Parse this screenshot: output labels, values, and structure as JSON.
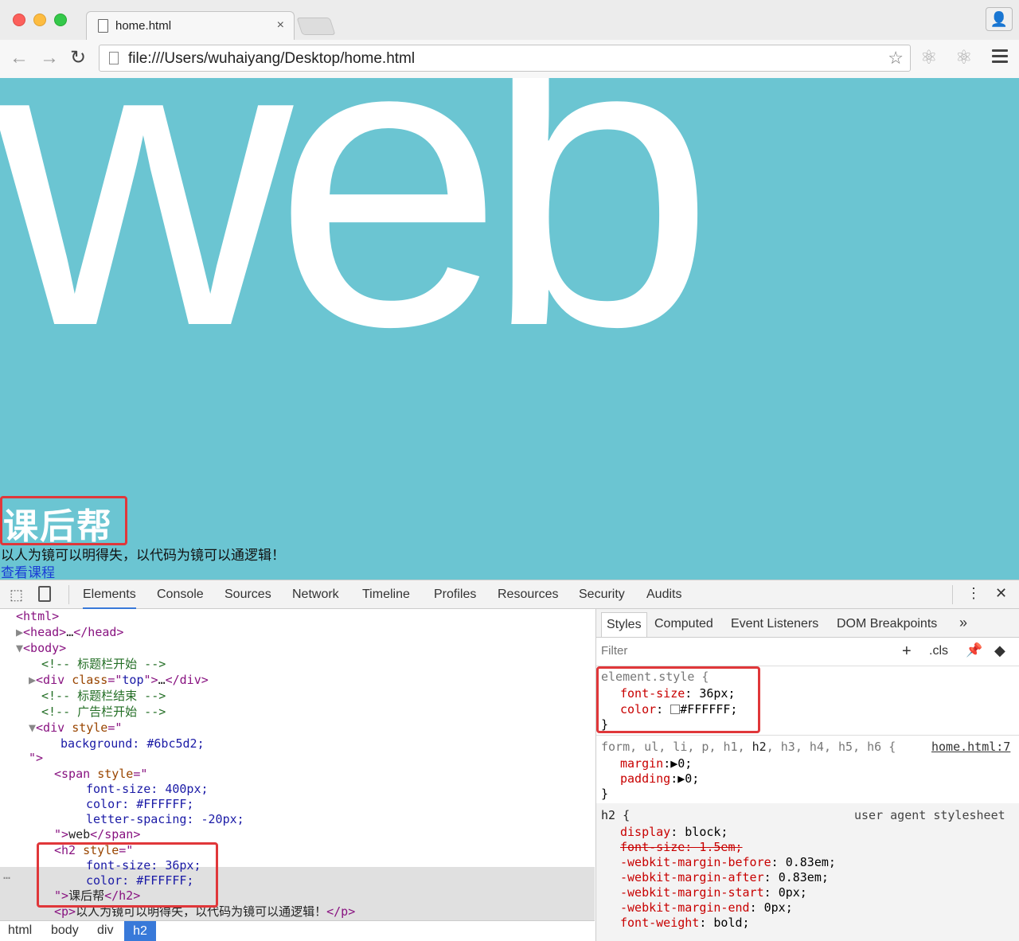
{
  "browser": {
    "tab_title": "home.html",
    "tab_close": "×",
    "url": "file:///Users/wuhaiyang/Desktop/home.html",
    "back": "←",
    "forward": "→",
    "reload": "↻",
    "star": "☆"
  },
  "page": {
    "big_word": "web",
    "heading": "课后帮",
    "paragraph": "以人为镜可以明得失，以代码为镜可以通逻辑！",
    "link": "查看课程",
    "background_color": "#6bc5d2"
  },
  "devtools": {
    "tabs": [
      "Elements",
      "Console",
      "Sources",
      "Network",
      "Timeline",
      "Profiles",
      "Resources",
      "Security",
      "Audits"
    ],
    "selected_tab": "Elements",
    "more": "⋮",
    "close": "✕",
    "dom": {
      "l1": "<html>",
      "l2a": "<head>",
      "l2b": "…",
      "l2c": "</head>",
      "l3": "<body>",
      "l4": "<!-- 标题栏开始 -->",
      "l5a": "<div ",
      "l5b": "class",
      "l5c": "=\"",
      "l5d": "top",
      "l5e": "\">",
      "l5f": "…",
      "l5g": "</div>",
      "l6": "<!-- 标题栏结束 -->",
      "l7": "<!-- 广告栏开始 -->",
      "l8a": "<div ",
      "l8b": "style",
      "l8c": "=\"",
      "l9": "background: #6bc5d2;",
      "l10": "\">",
      "l11a": "<span ",
      "l11b": "style",
      "l11c": "=\"",
      "l12": "font-size: 400px;",
      "l13": "color: #FFFFFF;",
      "l14": "letter-spacing: -20px;",
      "l15a": "\">",
      "l15b": "web",
      "l15c": "</span>",
      "l16a": "<h2 ",
      "l16b": "style",
      "l16c": "=\"",
      "l17": "font-size: 36px;",
      "l18": "color: #FFFFFF;",
      "l19a": "\">",
      "l19b": "课后帮",
      "l19c": "</h2>",
      "l20a": "<p>",
      "l20b": "以人为镜可以明得失，以代码为镜可以通逻辑！",
      "l20c": "</p>",
      "ellipsis": "…"
    },
    "breadcrumbs": [
      "html",
      "body",
      "div",
      "h2"
    ],
    "styles_tabs": [
      "Styles",
      "Computed",
      "Event Listeners",
      "DOM Breakpoints",
      "»"
    ],
    "filter_placeholder": "Filter",
    "filter_buttons": {
      "add": "+",
      "cls": ".cls"
    },
    "rules": {
      "element_selector": "element.style {",
      "e1n": "font-size",
      "e1v": "36px;",
      "e2n": "color",
      "e2v": "#FFFFFF;",
      "close": "}",
      "r2_selector_a": "form, ul, li, p, h1, ",
      "r2_selector_b": "h2",
      "r2_selector_c": ", h3, h4, h5, h6 {",
      "r2_source": "home.html:7",
      "r2p1n": "margin",
      "r2p1v": "▶0;",
      "r2p2n": "padding",
      "r2p2v": "▶0;",
      "r3_selector": "h2 {",
      "r3_source": "user agent stylesheet",
      "r3p1n": "display",
      "r3p1v": "block;",
      "r3p2": "font-size: 1.5em;",
      "r3p3n": "-webkit-margin-before",
      "r3p3v": "0.83em;",
      "r3p4n": "-webkit-margin-after",
      "r3p4v": "0.83em;",
      "r3p5n": "-webkit-margin-start",
      "r3p5v": "0px;",
      "r3p6n": "-webkit-margin-end",
      "r3p6v": "0px;",
      "r3p7n": "font-weight",
      "r3p7v": "bold;"
    }
  },
  "colors": {
    "highlight": "#e0373a",
    "accent": "#3879d9"
  }
}
